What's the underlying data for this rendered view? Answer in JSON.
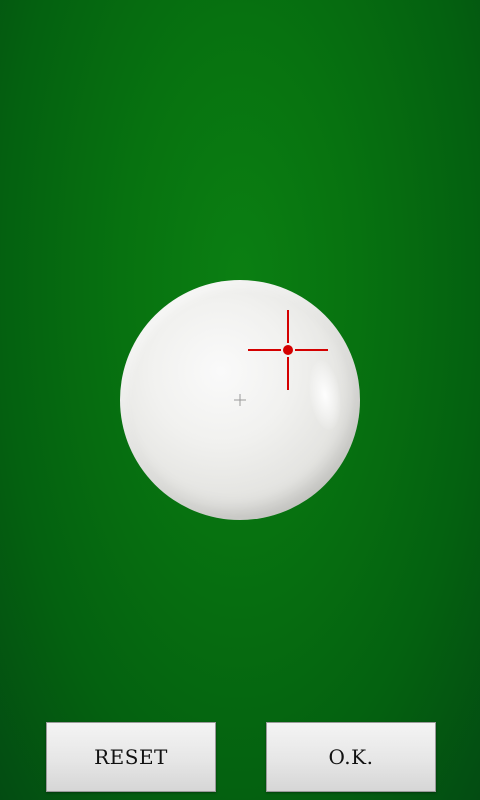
{
  "game": {
    "view": "cue-ball-spin-selector",
    "felt_color": "#077210",
    "crosshair_color": "#d40000"
  },
  "buttons": {
    "reset_label": "RESET",
    "ok_label": "O.K."
  }
}
